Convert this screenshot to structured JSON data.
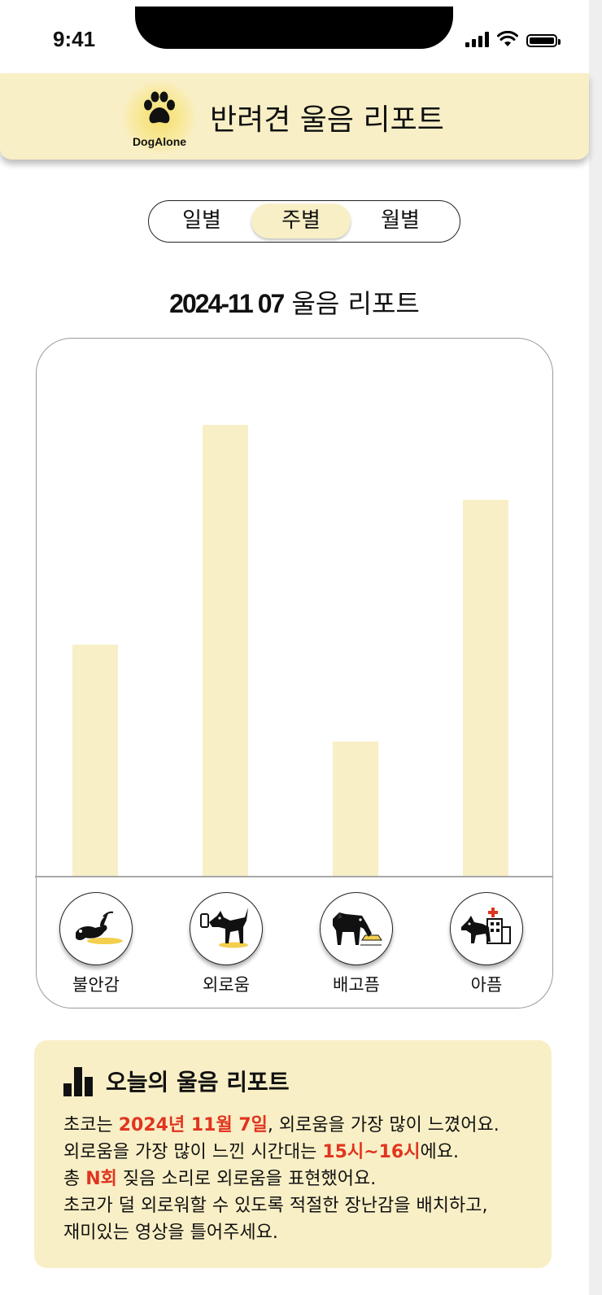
{
  "status_bar": {
    "time": "9:41"
  },
  "header": {
    "logo_text": "DogAlone",
    "title": "반려견 울음 리포트"
  },
  "tabs": [
    {
      "label": "일별",
      "active": false
    },
    {
      "label": "주별",
      "active": true
    },
    {
      "label": "월별",
      "active": false
    }
  ],
  "report": {
    "date": "2024-11 07",
    "title": "울음 리포트"
  },
  "chart_data": {
    "type": "bar",
    "categories": [
      "불안감",
      "외로움",
      "배고픔",
      "아픔"
    ],
    "values": [
      43,
      84,
      25,
      70
    ],
    "ylim": [
      0,
      100
    ],
    "title": "",
    "xlabel": "",
    "ylabel": "",
    "grid": false,
    "bar_color": "#f9efc6"
  },
  "categories": [
    {
      "label": "불안감",
      "icon": "anxious-dog-icon"
    },
    {
      "label": "외로움",
      "icon": "lonely-dog-icon"
    },
    {
      "label": "배고픔",
      "icon": "hungry-dog-icon"
    },
    {
      "label": "아픔",
      "icon": "sick-dog-icon"
    }
  ],
  "summary": {
    "title": "오늘의 울음 리포트",
    "line1_a": "초코는 ",
    "line1_hl": "2024년 11월 7일",
    "line1_b": ", 외로움을 가장 많이 느꼈어요.",
    "line2_a": "외로움을 가장 많이 느낀 시간대는 ",
    "line2_hl": "15시~16시",
    "line2_b": "에요.",
    "line3_a": "총 ",
    "line3_hl": "N회",
    "line3_b": " 짖음 소리로 외로움을 표현했어요.",
    "line4": "초코가 덜 외로워할 수 있도록 적절한 장난감을 배치하고,",
    "line5": "재미있는 영상을 틀어주세요."
  },
  "colors": {
    "accent": "#f9efc6",
    "highlight": "#e0351f"
  }
}
